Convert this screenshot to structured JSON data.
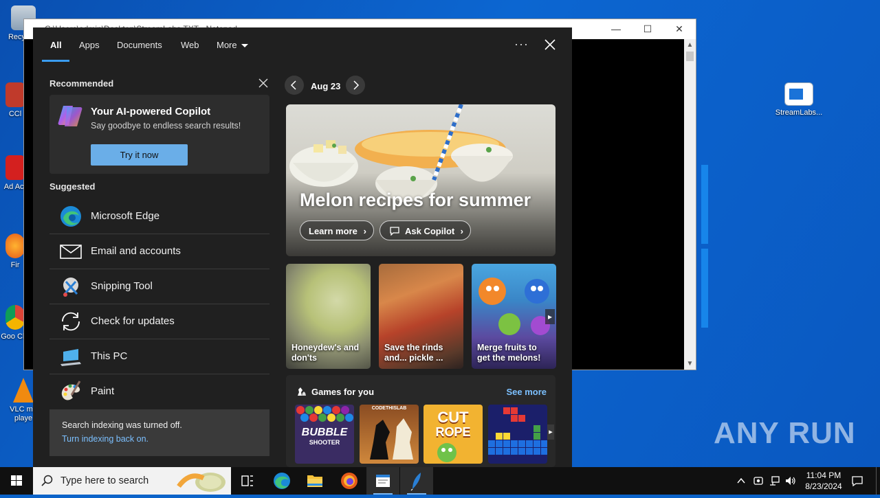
{
  "desktop": {
    "icons": [
      {
        "label": "Recycle Bin",
        "display": "Recy Bin"
      },
      {
        "label": "CCleaner",
        "display": "CCl"
      },
      {
        "label": "Adobe Acrobat",
        "display": "Ad Acr"
      },
      {
        "label": "Firefox",
        "display": "Fir"
      },
      {
        "label": "Google Chrome",
        "display": "Goo Chr"
      },
      {
        "label": "VLC media player",
        "display": "VLC me playe"
      }
    ],
    "right_icon": {
      "label": "StreamLabs..."
    },
    "watermark": "ANY RUN"
  },
  "background_window": {
    "title": "C:\\Users\\admin\\Desktop\\StreamLabs.TXT - Notepad",
    "minimize": "—",
    "maximize": "☐",
    "close": "✕"
  },
  "search_panel": {
    "tabs": [
      {
        "label": "All",
        "active": true
      },
      {
        "label": "Apps"
      },
      {
        "label": "Documents"
      },
      {
        "label": "Web"
      },
      {
        "label": "More"
      }
    ],
    "more_options": "···",
    "recommended": {
      "heading": "Recommended",
      "card_title": "Your AI-powered Copilot",
      "card_subtitle": "Say goodbye to endless search results!",
      "button": "Try it now"
    },
    "suggested": {
      "heading": "Suggested",
      "items": [
        {
          "label": "Microsoft Edge",
          "icon": "edge-icon"
        },
        {
          "label": "Email and accounts",
          "icon": "mail-icon"
        },
        {
          "label": "Snipping Tool",
          "icon": "snipping-tool-icon"
        },
        {
          "label": "Check for updates",
          "icon": "refresh-icon"
        },
        {
          "label": "This PC",
          "icon": "computer-icon"
        },
        {
          "label": "Paint",
          "icon": "paint-icon"
        }
      ]
    },
    "indexing": {
      "message": "Search indexing was turned off.",
      "link": "Turn indexing back on."
    },
    "highlights": {
      "date": "Aug 23",
      "hero": {
        "title": "Melon recipes for summer",
        "learn_more": "Learn more",
        "ask_copilot": "Ask Copilot"
      },
      "cards": [
        {
          "title": "Honeydew's and don'ts"
        },
        {
          "title": "Save the rinds and... pickle ..."
        },
        {
          "title": "Merge fruits to get the melons!"
        }
      ],
      "games": {
        "heading": "Games for you",
        "see_more": "See more",
        "items": [
          {
            "line1": "BUBBLE",
            "line2": "SHOOTER"
          },
          {
            "line1": "CODETHISLAB"
          },
          {
            "line1": "CUT",
            "line2": "ROPE"
          },
          {
            "line1": ""
          }
        ]
      }
    }
  },
  "taskbar": {
    "search_placeholder": "Type here to search",
    "time": "11:04 PM",
    "date": "8/23/2024"
  }
}
